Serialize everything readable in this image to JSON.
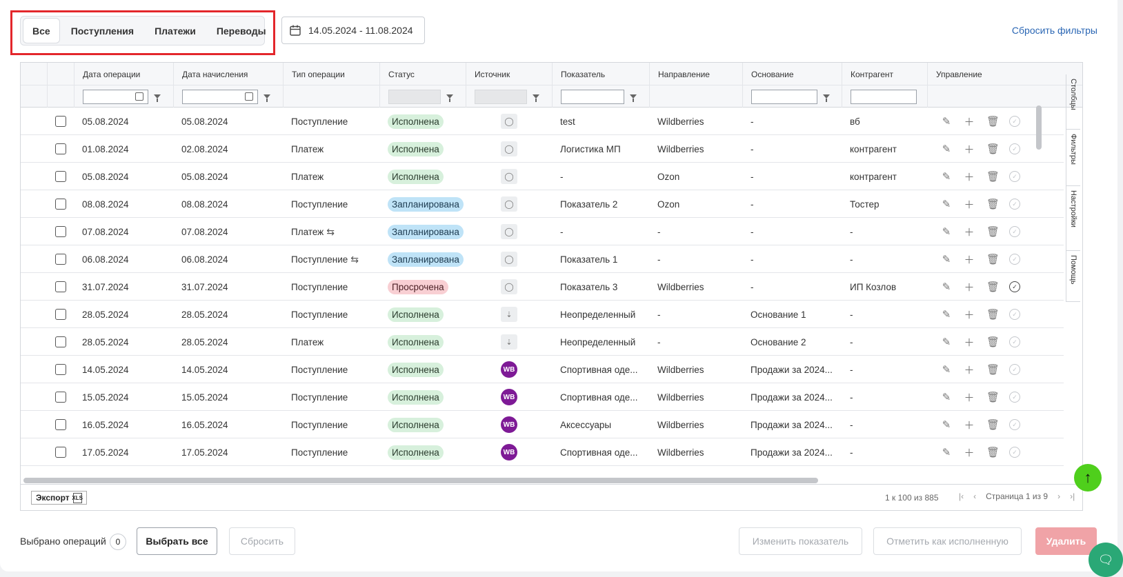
{
  "tabs": [
    {
      "label": "Все",
      "active": true
    },
    {
      "label": "Поступления",
      "active": false
    },
    {
      "label": "Платежи",
      "active": false
    },
    {
      "label": "Переводы",
      "active": false
    }
  ],
  "date_range": "14.05.2024 - 11.08.2024",
  "reset_filters": "Сбросить фильтры",
  "columns": [
    "Дата операции",
    "Дата начисления",
    "Тип операции",
    "Статус",
    "Источник",
    "Показатель",
    "Направление",
    "Основание",
    "Контрагент",
    "Управление"
  ],
  "rows": [
    {
      "op_date": "05.08.2024",
      "accr_date": "05.08.2024",
      "type": "Поступление",
      "transfer": false,
      "status": "Исполнена",
      "status_kind": "done",
      "source": "user",
      "indicator": "test",
      "direction": "Wildberries",
      "basis": "-",
      "counterparty": "вб",
      "confirmed": false
    },
    {
      "op_date": "01.08.2024",
      "accr_date": "02.08.2024",
      "type": "Платеж",
      "transfer": false,
      "status": "Исполнена",
      "status_kind": "done",
      "source": "user",
      "indicator": "Логистика МП",
      "direction": "Wildberries",
      "basis": "-",
      "counterparty": "контрагент",
      "confirmed": false
    },
    {
      "op_date": "05.08.2024",
      "accr_date": "05.08.2024",
      "type": "Платеж",
      "transfer": false,
      "status": "Исполнена",
      "status_kind": "done",
      "source": "user",
      "indicator": "-",
      "direction": "Ozon",
      "basis": "-",
      "counterparty": "контрагент",
      "confirmed": false
    },
    {
      "op_date": "08.08.2024",
      "accr_date": "08.08.2024",
      "type": "Поступление",
      "transfer": false,
      "status": "Запланирована",
      "status_kind": "plan",
      "source": "user",
      "indicator": "Показатель 2",
      "direction": "Ozon",
      "basis": "-",
      "counterparty": "Тостер",
      "confirmed": false
    },
    {
      "op_date": "07.08.2024",
      "accr_date": "07.08.2024",
      "type": "Платеж",
      "transfer": true,
      "status": "Запланирована",
      "status_kind": "plan",
      "source": "user",
      "indicator": "-",
      "direction": "-",
      "basis": "-",
      "counterparty": "-",
      "confirmed": false
    },
    {
      "op_date": "06.08.2024",
      "accr_date": "06.08.2024",
      "type": "Поступление",
      "transfer": true,
      "status": "Запланирована",
      "status_kind": "plan",
      "source": "user",
      "indicator": "Показатель 1",
      "direction": "-",
      "basis": "-",
      "counterparty": "-",
      "confirmed": false
    },
    {
      "op_date": "31.07.2024",
      "accr_date": "31.07.2024",
      "type": "Поступление",
      "transfer": false,
      "status": "Просрочена",
      "status_kind": "late",
      "source": "user",
      "indicator": "Показатель 3",
      "direction": "Wildberries",
      "basis": "-",
      "counterparty": "ИП Козлов",
      "confirmed": true
    },
    {
      "op_date": "28.05.2024",
      "accr_date": "28.05.2024",
      "type": "Поступление",
      "transfer": false,
      "status": "Исполнена",
      "status_kind": "done",
      "source": "file",
      "indicator": "Неопределенный",
      "direction": "-",
      "basis": "Основание 1",
      "counterparty": "-",
      "confirmed": false
    },
    {
      "op_date": "28.05.2024",
      "accr_date": "28.05.2024",
      "type": "Платеж",
      "transfer": false,
      "status": "Исполнена",
      "status_kind": "done",
      "source": "file",
      "indicator": "Неопределенный",
      "direction": "-",
      "basis": "Основание 2",
      "counterparty": "-",
      "confirmed": false
    },
    {
      "op_date": "14.05.2024",
      "accr_date": "14.05.2024",
      "type": "Поступление",
      "transfer": false,
      "status": "Исполнена",
      "status_kind": "done",
      "source": "wb",
      "indicator": "Спортивная оде...",
      "direction": "Wildberries",
      "basis": "Продажи за 2024...",
      "counterparty": "-",
      "confirmed": false
    },
    {
      "op_date": "15.05.2024",
      "accr_date": "15.05.2024",
      "type": "Поступление",
      "transfer": false,
      "status": "Исполнена",
      "status_kind": "done",
      "source": "wb",
      "indicator": "Спортивная оде...",
      "direction": "Wildberries",
      "basis": "Продажи за 2024...",
      "counterparty": "-",
      "confirmed": false
    },
    {
      "op_date": "16.05.2024",
      "accr_date": "16.05.2024",
      "type": "Поступление",
      "transfer": false,
      "status": "Исполнена",
      "status_kind": "done",
      "source": "wb",
      "indicator": "Аксессуары",
      "direction": "Wildberries",
      "basis": "Продажи за 2024...",
      "counterparty": "-",
      "confirmed": false
    },
    {
      "op_date": "17.05.2024",
      "accr_date": "17.05.2024",
      "type": "Поступление",
      "transfer": false,
      "status": "Исполнена",
      "status_kind": "done",
      "source": "wb",
      "indicator": "Спортивная оде...",
      "direction": "Wildberries",
      "basis": "Продажи за 2024...",
      "counterparty": "-",
      "confirmed": false
    }
  ],
  "wb_label": "WB",
  "sidebar_tabs": [
    "Столбцы",
    "Фильтры",
    "Настройки",
    "Помощь"
  ],
  "footer": {
    "export": "Экспорт",
    "export_icon": "XLS",
    "count": "1 к 100 из 885",
    "page": "Страница 1 из 9"
  },
  "bottom": {
    "selected_label": "Выбрано операций",
    "selected_count": "0",
    "select_all": "Выбрать все",
    "reset": "Сбросить",
    "change_indicator": "Изменить показатель",
    "mark_done": "Отметить как исполненную",
    "delete": "Удалить"
  }
}
